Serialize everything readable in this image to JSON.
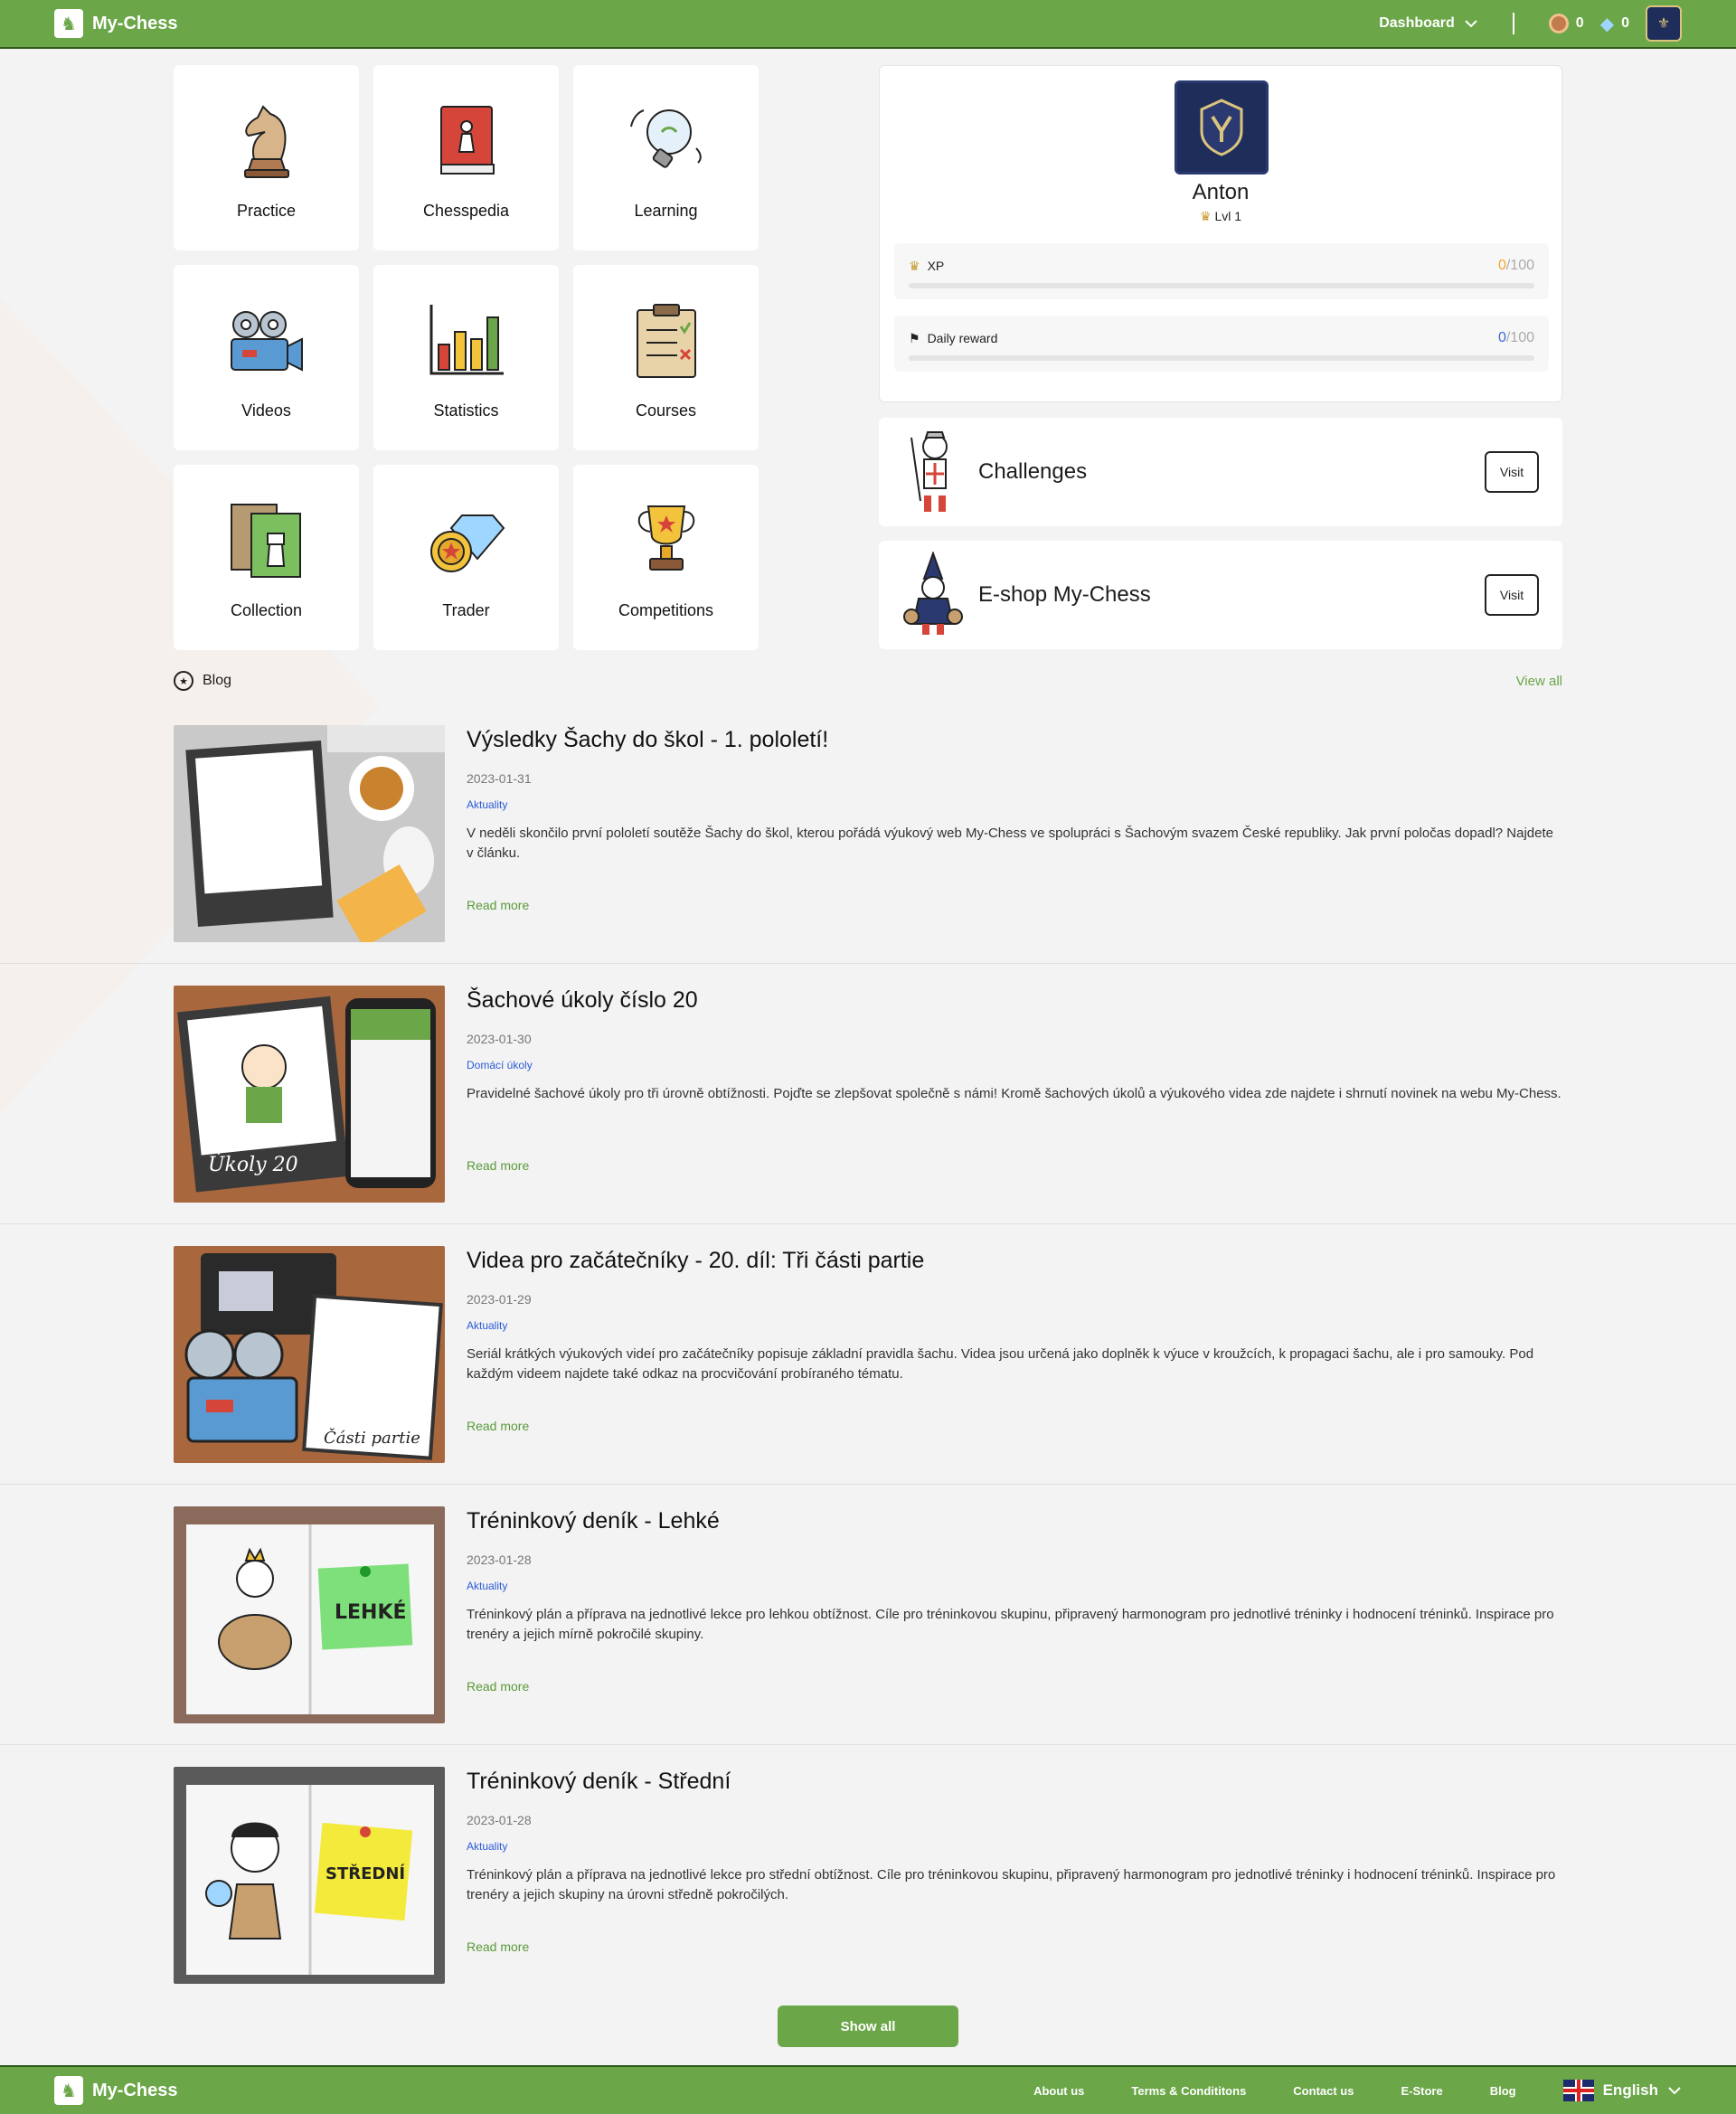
{
  "header": {
    "brand": "My-Chess",
    "dashboard_label": "Dashboard",
    "coins": "0",
    "gems": "0"
  },
  "tiles": [
    {
      "label": "Practice",
      "icon": "knight-icon"
    },
    {
      "label": "Chesspedia",
      "icon": "book-icon"
    },
    {
      "label": "Learning",
      "icon": "lightbulb-icon"
    },
    {
      "label": "Videos",
      "icon": "video-camera-icon"
    },
    {
      "label": "Statistics",
      "icon": "bar-chart-icon"
    },
    {
      "label": "Courses",
      "icon": "clipboard-icon"
    },
    {
      "label": "Collection",
      "icon": "cards-icon"
    },
    {
      "label": "Trader",
      "icon": "diamond-coin-icon"
    },
    {
      "label": "Competitions",
      "icon": "trophy-icon"
    }
  ],
  "profile": {
    "name": "Anton",
    "level": "Lvl 1",
    "xp": {
      "label": "XP",
      "value": "0",
      "max": "/100",
      "fraction": 0
    },
    "daily": {
      "label": "Daily reward",
      "value": "0",
      "max": "/100",
      "fraction": 0
    }
  },
  "side_cards": [
    {
      "title": "Challenges",
      "button": "Visit"
    },
    {
      "title": "E-shop My-Chess",
      "button": "Visit"
    }
  ],
  "blog": {
    "title": "Blog",
    "view_all": "View all",
    "read_more": "Read more",
    "posts": [
      {
        "title": "Výsledky Šachy do škol - 1. pololetí!",
        "date": "2023-01-31",
        "tag": "Aktuality",
        "excerpt": "V neděli skončilo první pololetí soutěže Šachy do škol, kterou pořádá výukový web My-Chess ve spolupráci s Šachovým svazem České republiky. Jak první poločas dopadl? Najdete v článku."
      },
      {
        "title": "Šachové úkoly číslo 20",
        "date": "2023-01-30",
        "tag": "Domácí úkoly",
        "excerpt": "Pravidelné šachové úkoly pro tři úrovně obtížnosti. Pojďte se zlepšovat společně s námi! Kromě šachových úkolů a výukového videa zde najdete i shrnutí novinek na webu My-Chess."
      },
      {
        "title": "Videa pro začátečníky - 20. díl: Tři části partie",
        "date": "2023-01-29",
        "tag": "Aktuality",
        "excerpt": "Seriál krátkých výukových videí pro začátečníky popisuje základní pravidla šachu. Videa jsou určená jako doplněk k výuce v kroužcích, k propagaci šachu, ale i pro samouky. Pod každým videem najdete také odkaz na procvičování probíraného tématu."
      },
      {
        "title": "Tréninkový deník - Lehké",
        "date": "2023-01-28",
        "tag": "Aktuality",
        "excerpt": "Tréninkový plán a příprava na jednotlivé lekce pro lehkou obtížnost. Cíle pro tréninkovou skupinu, připravený harmonogram pro jednotlivé tréninky i hodnocení tréninků. Inspirace pro trenéry a jejich mírně pokročilé skupiny."
      },
      {
        "title": "Tréninkový deník - Střední",
        "date": "2023-01-28",
        "tag": "Aktuality",
        "excerpt": "Tréninkový plán a příprava na jednotlivé lekce pro střední obtížnost. Cíle pro tréninkovou skupinu, připravený harmonogram pro jednotlivé tréninky i hodnocení tréninků. Inspirace pro trenéry a jejich skupiny na úrovni středně pokročilých."
      }
    ],
    "thumb_texts": [
      "Úkoly 20",
      "Části partie",
      "LEHKÉ",
      "STŘEDNÍ"
    ],
    "show_all": "Show all"
  },
  "footer": {
    "brand": "My-Chess",
    "links": [
      "About us",
      "Terms & Condititons",
      "Contact us",
      "E-Store",
      "Blog"
    ],
    "language": "English"
  },
  "colors": {
    "brand": "#6ba648",
    "brand_dark": "#2f5a17",
    "link_blue": "#2a5bd7"
  }
}
